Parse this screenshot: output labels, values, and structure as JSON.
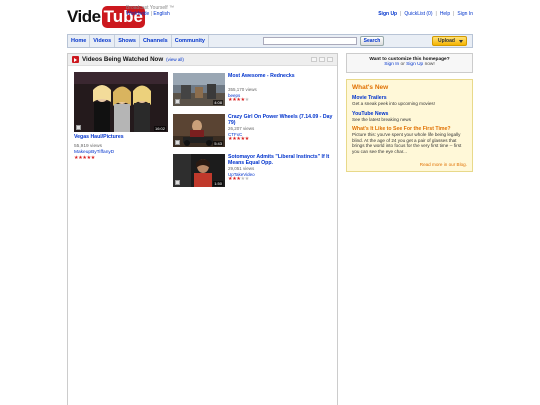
{
  "header": {
    "logo_part1": "Vide",
    "logo_part2": "Tube",
    "tagline": "Broadcast Yourself",
    "locale_worldwide": "Worldwide",
    "locale_language": "English",
    "links": {
      "signup": "Sign Up",
      "quicklist": "QuickList",
      "quicklist_count": "(0)",
      "help": "Help",
      "signin": "Sign In"
    }
  },
  "nav": {
    "tabs": [
      "Home",
      "Videos",
      "Shows",
      "Channels",
      "Community"
    ],
    "search_value": "",
    "search_button": "Search",
    "upload_button": "Upload"
  },
  "main": {
    "title": "Videos Being Watched Now",
    "view_all": "(view all)",
    "featured": {
      "title": "Vegas Haul/Pictures",
      "duration": "16:02",
      "views": "55,919 views",
      "user": "MakeupByTiffanyD",
      "rating": 5
    },
    "items": [
      {
        "title": "Most Awesome - Rednecks",
        "duration": "4:08",
        "views": "355,170 views",
        "user": "beeps",
        "rating": 4
      },
      {
        "title": "Crazy Girl On Power Wheels (7.14.09 - Day 79)",
        "duration": "5:43",
        "views": "26,207 views",
        "user": "CTFxC",
        "rating": 5
      },
      {
        "title": "Sotomayor Admits \"Liberal Instincts\" If It Means Equal Opp.",
        "duration": "1:50",
        "views": "29,051 views",
        "user": "UpTakeVideo",
        "rating": 3
      }
    ]
  },
  "sidebar": {
    "customize_title": "Want to customize this homepage?",
    "signin": "Sign In",
    "or": "or",
    "signup": "Sign Up",
    "now": "now!",
    "whatsnew_title": "What's New",
    "news": [
      {
        "head": "Movie Trailers",
        "text": "Get a sneak peek into upcoming movies!"
      },
      {
        "head": "YouTube News",
        "text": "See the latest breaking news"
      },
      {
        "head": "What's It Like to See For the First Time?",
        "text": "Picture this: you've spent your whole life being legally blind. At the age of 24 you get a pair of glasses that brings the world into focus for the very first time -- first you can see the eye char..."
      }
    ],
    "read_more": "Read more in our Blog."
  }
}
